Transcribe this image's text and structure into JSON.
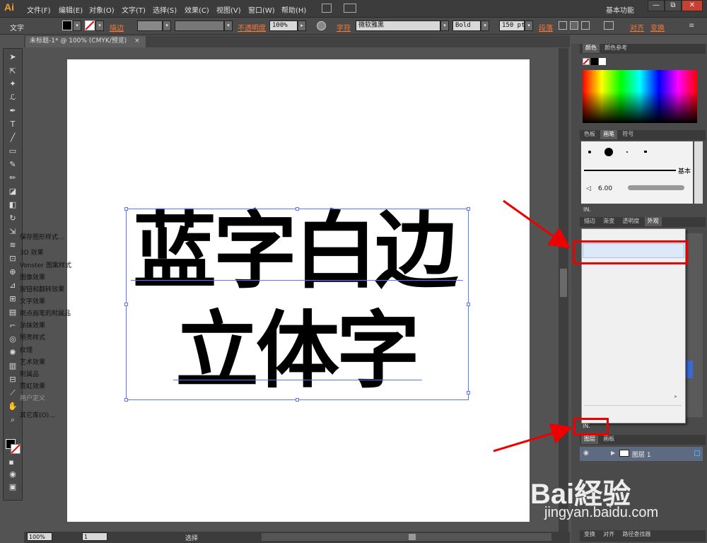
{
  "app": {
    "logo": "Ai"
  },
  "menu": [
    "文件(F)",
    "编辑(E)",
    "对象(O)",
    "文字(T)",
    "选择(S)",
    "效果(C)",
    "视图(V)",
    "窗口(W)",
    "帮助(H)"
  ],
  "workspace": "基本功能",
  "window_buttons": [
    "—",
    "⧉",
    "✕"
  ],
  "control_bar": {
    "mode_label": "文字",
    "stroke_label": "描边",
    "opacity_label": "不透明度",
    "opacity_value": "100%",
    "char_label": "字符",
    "font_name": "微软雅黑",
    "font_style": "Bold",
    "font_size": "150 pt",
    "para_label": "段落",
    "align_label": "对齐",
    "transform_label": "变换"
  },
  "document_tab": {
    "title": "未标题-1* @ 100% (CMYK/预览)",
    "close": "×"
  },
  "canvas": {
    "line1": "蓝字白边",
    "line2": "立体字"
  },
  "status_bar": {
    "zoom": "100%",
    "page": "1",
    "tool": "选择"
  },
  "panels": {
    "color_tabs": [
      "颜色",
      "颜色参考"
    ],
    "swatch_tabs": [
      "色板",
      "画笔",
      "符号"
    ],
    "brush_basic": "基本",
    "brush_size": "6.00",
    "appearance_tabs": [
      "描边",
      "渐变",
      "透明度",
      "外观"
    ],
    "library_button": "IN.",
    "layers_tabs": [
      "图层",
      "画板"
    ],
    "layer_name": "图层 1",
    "bottom_tabs": [
      "变换",
      "对齐",
      "路径查找器"
    ]
  },
  "dropdown": {
    "items": [
      {
        "label": "保存图形样式...",
        "disabled": false
      },
      {
        "label": "3D 效果",
        "disabled": false,
        "highlighted": true
      },
      {
        "label": "Vonster 图案样式",
        "disabled": false
      },
      {
        "label": "图像效果",
        "disabled": false
      },
      {
        "label": "按钮和翻转效果",
        "disabled": false
      },
      {
        "label": "文字效果",
        "disabled": false
      },
      {
        "label": "斑点画笔的附属品",
        "disabled": false
      },
      {
        "label": "涂抹效果",
        "disabled": false
      },
      {
        "label": "照亮样式",
        "disabled": false
      },
      {
        "label": "纹理",
        "disabled": false
      },
      {
        "label": "艺术效果",
        "disabled": false
      },
      {
        "label": "附属品",
        "disabled": false
      },
      {
        "label": "霓虹效果",
        "disabled": false
      },
      {
        "label": "用户定义",
        "disabled": true
      },
      {
        "label": "其它库(O)...",
        "disabled": false
      }
    ]
  },
  "watermark": {
    "brand": "Bai経验",
    "url": "jingyan.baidu.com"
  },
  "colors": {
    "accent": "#ff7733",
    "highlight_red": "#ee0000",
    "selection": "#5577ff"
  }
}
